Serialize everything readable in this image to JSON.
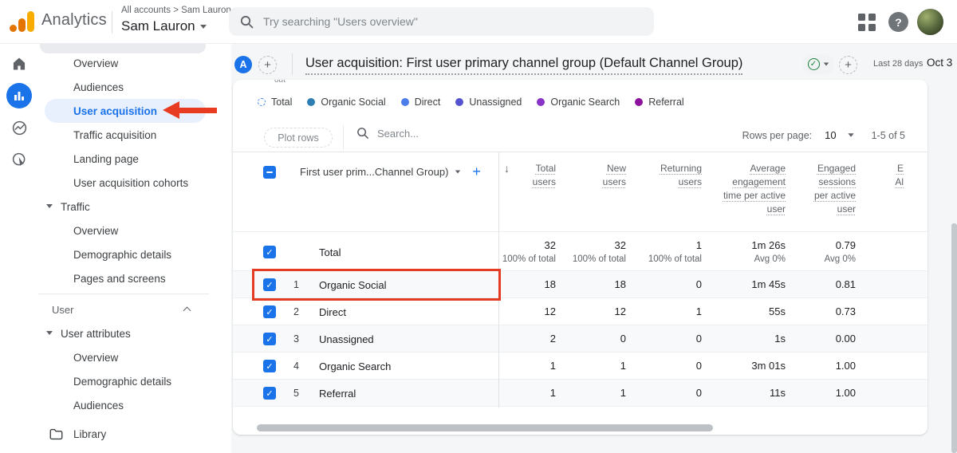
{
  "colors": {
    "accent_blue": "#1a73e8",
    "annotation_red": "#e83c22",
    "logo_orange": "#f9ab00",
    "logo_dark_orange": "#e37400",
    "approved_green": "#188038"
  },
  "topbar": {
    "brand": "Analytics",
    "breadcrumb": "All accounts > Sam Lauron",
    "account": "Sam Lauron",
    "search_placeholder": "Try searching \"Users overview\""
  },
  "sidebar": {
    "items": [
      {
        "label": "Overview"
      },
      {
        "label": "Audiences"
      },
      {
        "label": "User acquisition"
      },
      {
        "label": "Traffic acquisition"
      },
      {
        "label": "Landing page"
      },
      {
        "label": "User acquisition cohorts"
      },
      {
        "label": "Traffic"
      },
      {
        "label": "Overview"
      },
      {
        "label": "Demographic details"
      },
      {
        "label": "Pages and screens"
      },
      {
        "label": "User"
      },
      {
        "label": "User attributes"
      },
      {
        "label": "Overview"
      },
      {
        "label": "Demographic details"
      },
      {
        "label": "Audiences"
      },
      {
        "label": "Library"
      }
    ]
  },
  "header": {
    "property_badge": "A",
    "title": "User acquisition: First user primary channel group (Default Channel Group)",
    "approved_check": "✓",
    "date_range": "Last 28 days",
    "date_start": "Oct 3"
  },
  "card": {
    "clipped_text": "out",
    "legend": [
      {
        "label": "Total",
        "color": "#4285f4",
        "style": "dashed"
      },
      {
        "label": "Organic Social",
        "color": "#2d7db3",
        "style": "solid"
      },
      {
        "label": "Direct",
        "color": "#4c7eea",
        "style": "solid"
      },
      {
        "label": "Unassigned",
        "color": "#5553cf",
        "style": "solid"
      },
      {
        "label": "Organic Search",
        "color": "#8833c7",
        "style": "solid"
      },
      {
        "label": "Referral",
        "color": "#8c119c",
        "style": "solid"
      }
    ],
    "toolbar": {
      "plot_rows_label": "Plot rows",
      "search_placeholder": "Search...",
      "rows_per_page_label": "Rows per page:",
      "rows_per_page_value": "10",
      "range": "1-5 of 5"
    },
    "table": {
      "dimension_header": "First user prim...Channel Group)",
      "sort_icon": "↓",
      "columns": [
        "Total users",
        "New users",
        "Returning users",
        "Average engagement time per active user",
        "Engaged sessions per active user"
      ],
      "truncated_column": {
        "line1": "E",
        "line2": "Al"
      },
      "total_row": {
        "label": "Total",
        "values": [
          "32",
          "32",
          "1",
          "1m 26s",
          "0.79"
        ],
        "notes": [
          "100% of total",
          "100% of total",
          "100% of total",
          "Avg 0%",
          "Avg 0%"
        ]
      },
      "rows": [
        {
          "index": "1",
          "name": "Organic Social",
          "values": [
            "18",
            "18",
            "0",
            "1m 45s",
            "0.81"
          ]
        },
        {
          "index": "2",
          "name": "Direct",
          "values": [
            "12",
            "12",
            "1",
            "55s",
            "0.73"
          ]
        },
        {
          "index": "3",
          "name": "Unassigned",
          "values": [
            "2",
            "0",
            "0",
            "1s",
            "0.00"
          ]
        },
        {
          "index": "4",
          "name": "Organic Search",
          "values": [
            "1",
            "1",
            "0",
            "3m 01s",
            "1.00"
          ]
        },
        {
          "index": "5",
          "name": "Referral",
          "values": [
            "1",
            "1",
            "0",
            "11s",
            "1.00"
          ]
        }
      ]
    }
  }
}
